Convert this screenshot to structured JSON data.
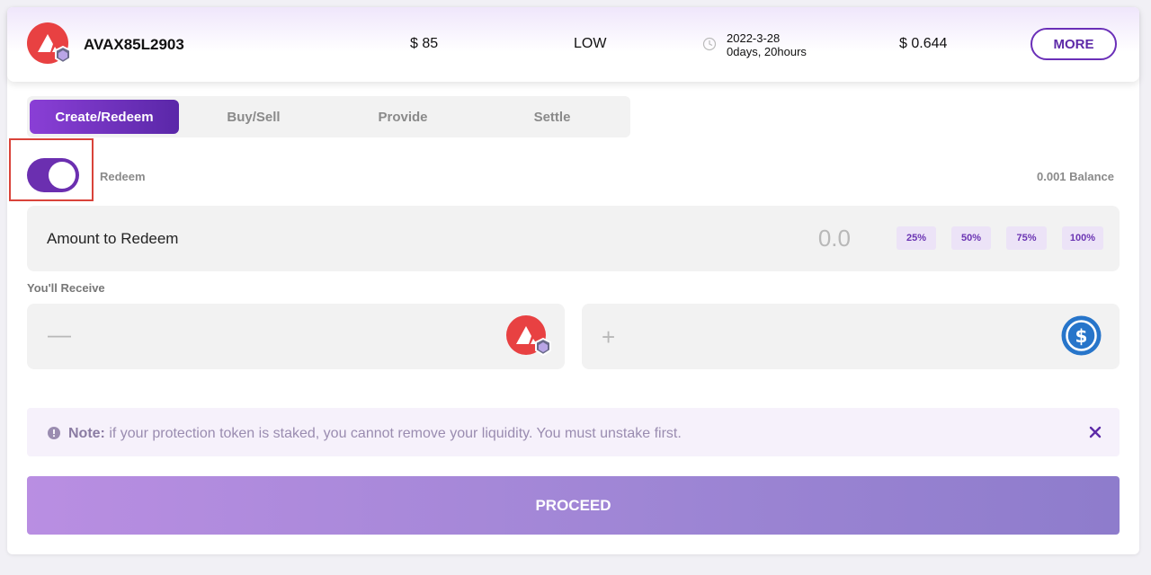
{
  "header": {
    "token_name": "AVAX85L2903",
    "price": "$ 85",
    "risk": "LOW",
    "date": "2022-3-28",
    "countdown": "0days, 20hours",
    "premium": "$ 0.644",
    "more_label": "MORE"
  },
  "tabs": [
    {
      "label": "Create/Redeem",
      "active": true
    },
    {
      "label": "Buy/Sell",
      "active": false
    },
    {
      "label": "Provide",
      "active": false
    },
    {
      "label": "Settle",
      "active": false
    }
  ],
  "redeem": {
    "toggle_label": "Redeem",
    "toggle_on": true,
    "balance": "0.001 Balance",
    "amount_label": "Amount to Redeem",
    "amount_placeholder": "0.0",
    "percentages": [
      "25%",
      "50%",
      "75%",
      "100%"
    ]
  },
  "receive": {
    "label": "You'll Receive",
    "left_sign": "—",
    "right_sign": "+"
  },
  "note": {
    "prefix": "Note:",
    "text": " if your protection token is staked, you cannot remove your liquidity. You must unstake first."
  },
  "proceed_label": "PROCEED",
  "colors": {
    "accent": "#6b2fb0",
    "avax_red": "#e84142",
    "usdc_blue": "#2775ca"
  },
  "icons": {
    "token": "avax-shield-logo",
    "clock": "clock-icon",
    "usdc": "usdc-logo",
    "info": "info-icon",
    "close": "close-icon"
  }
}
